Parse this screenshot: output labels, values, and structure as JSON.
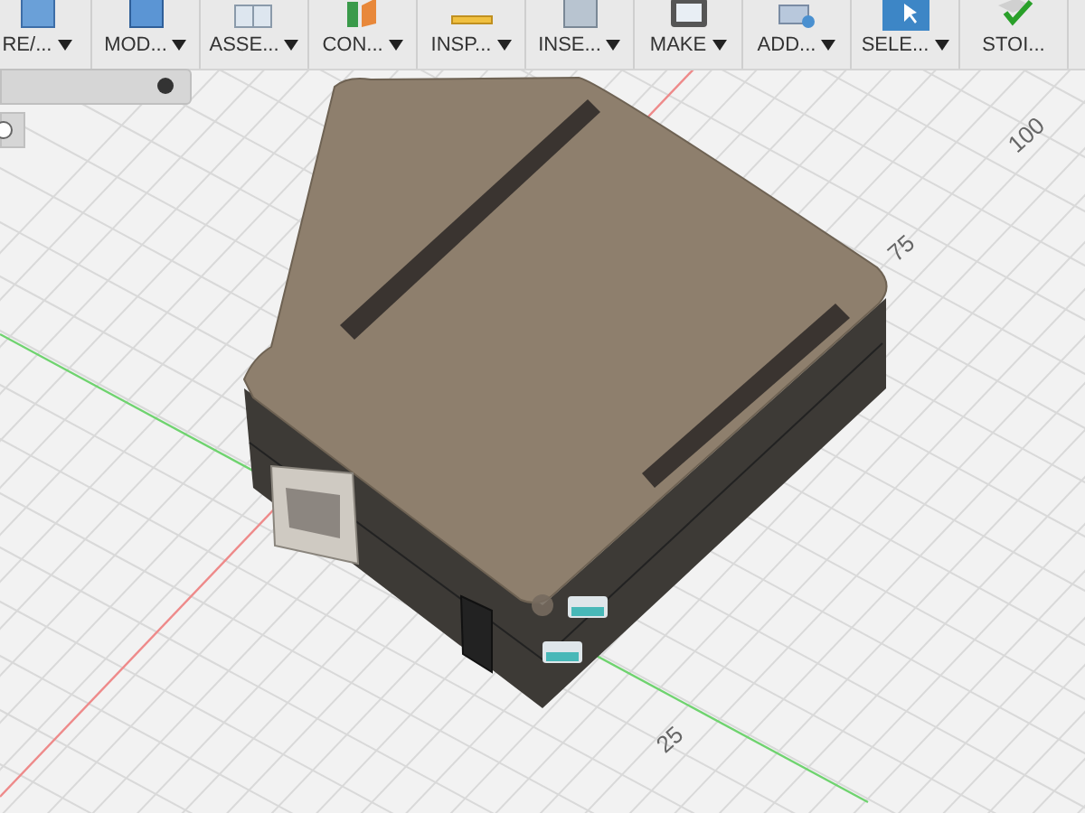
{
  "toolbar": [
    {
      "label": "RE/...",
      "dropdown": true,
      "selected": false
    },
    {
      "label": "MOD...",
      "dropdown": true,
      "selected": false
    },
    {
      "label": "ASSE...",
      "dropdown": true,
      "selected": false
    },
    {
      "label": "CON...",
      "dropdown": true,
      "selected": false
    },
    {
      "label": "INSP...",
      "dropdown": true,
      "selected": false
    },
    {
      "label": "INSE...",
      "dropdown": true,
      "selected": false
    },
    {
      "label": "MAKE",
      "dropdown": true,
      "selected": false
    },
    {
      "label": "ADD...",
      "dropdown": true,
      "selected": false
    },
    {
      "label": "SELE...",
      "dropdown": true,
      "selected": true
    },
    {
      "label": "STOI...",
      "dropdown": false,
      "selected": false
    }
  ],
  "viewport": {
    "axis_labels": [
      "100",
      "75",
      "25"
    ]
  }
}
